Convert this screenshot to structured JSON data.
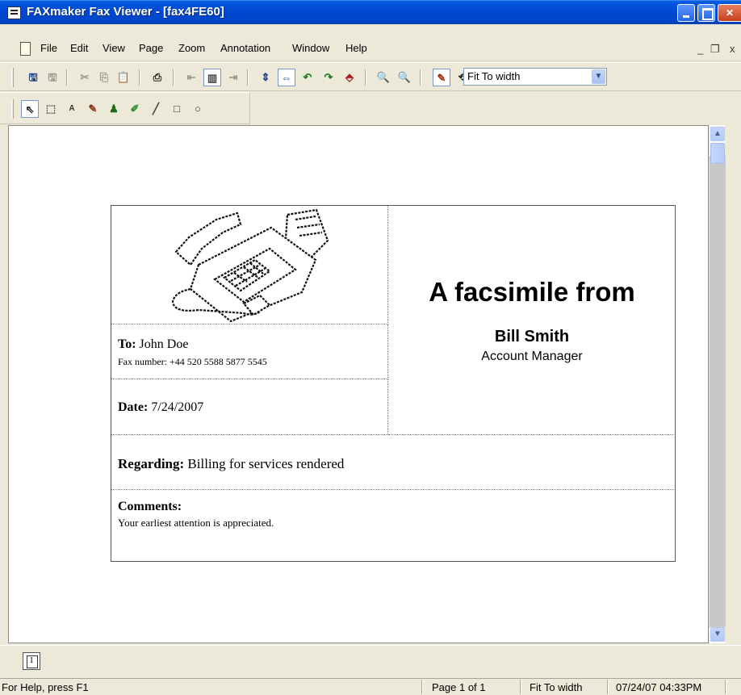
{
  "window": {
    "title": "FAXmaker Fax Viewer - [fax4FE60]",
    "controls": [
      "minimize",
      "maximize",
      "close"
    ]
  },
  "menubar": {
    "items": [
      "File",
      "Edit",
      "View",
      "Page",
      "Zoom",
      "Annotation",
      "Window",
      "Help"
    ],
    "mdi_minimize": "_",
    "mdi_restore": "❐",
    "mdi_close": "x"
  },
  "toolbar": {
    "zoom_mode": "Fit To width",
    "icons": [
      "save-icon",
      "save-as-icon",
      "cut-icon",
      "copy-icon",
      "paste-icon",
      "print-icon",
      "previous-page-icon",
      "page-view-icon",
      "next-page-icon",
      "fit-height-icon",
      "fit-width-icon",
      "rotate-left-icon",
      "rotate-right-icon",
      "flip-icon",
      "zoom-out-icon",
      "zoom-in-icon",
      "annotate-pen-icon",
      "lasso-icon",
      "thumbnails-icon"
    ]
  },
  "annotation_toolbar": {
    "icons": [
      "select-arrow-icon",
      "rectangle-select-icon",
      "text-annotation-icon",
      "pen-icon",
      "stamp-icon",
      "highlighter-icon",
      "line-icon",
      "rectangle-icon",
      "ellipse-icon"
    ]
  },
  "cover_page": {
    "from_heading": "A facsimile from",
    "sender_name": "Bill Smith",
    "sender_title": "Account Manager",
    "to_label": "To:",
    "to_value": "John Doe",
    "fax_number_label": "Fax number:",
    "fax_number_value": "+44 520 5588 5877 5545",
    "date_label": "Date:",
    "date_value": "7/24/2007",
    "regarding_label": "Regarding:",
    "regarding_value": "Billing for services rendered",
    "comments_label": "Comments:",
    "comments_value": "Your earliest attention is appreciated."
  },
  "pagebar": {
    "page_button_label": "1"
  },
  "status": {
    "help": "For Help, press F1",
    "page": "Page 1 of 1",
    "zoom": "Fit To width",
    "timestamp": "07/24/07 04:33PM"
  },
  "colors": {
    "titlebar": "#0046c8",
    "chrome": "#ece9d8",
    "close_button": "#c6401a"
  }
}
